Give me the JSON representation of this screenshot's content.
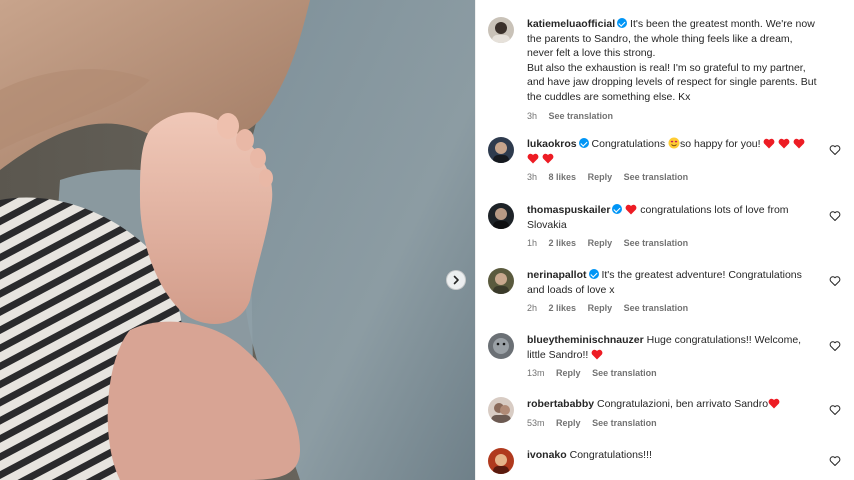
{
  "post": {
    "author": "katiemeluaofficial",
    "caption_paragraphs": [
      "It's been the greatest month. We're now the parents to Sandro, the whole thing feels like a dream, never felt a love this strong.",
      "But also the exhaustion is real! I'm so grateful to my partner, and have jaw dropping levels of respect for single parents. But the cuddles are something else. Kx"
    ],
    "time": "3h",
    "see_translation": "See translation"
  },
  "comments": [
    {
      "user": "lukaokros",
      "verified": true,
      "text_before": "Congratulations",
      "emoji": "grinning-hearts-face",
      "text_after": "so happy for you!",
      "hearts": 5,
      "time": "3h",
      "likes": "8 likes",
      "reply": "Reply",
      "see_translation": "See translation",
      "avatar_color": "#2e3b4e"
    },
    {
      "user": "thomaspuskailer",
      "verified": true,
      "emoji_before": true,
      "text": "congratulations lots of love from Slovakia",
      "time": "1h",
      "likes": "2 likes",
      "reply": "Reply",
      "see_translation": "See translation",
      "avatar_color": "#1e2328"
    },
    {
      "user": "nerinapallot",
      "verified": true,
      "text": "It's the greatest adventure! Congratulations and loads of love x",
      "time": "2h",
      "likes": "2 likes",
      "reply": "Reply",
      "see_translation": "See translation",
      "avatar_color": "#5a5a3e"
    },
    {
      "user": "blueytheminischnauzer",
      "verified": false,
      "text": "Huge congratulations!! Welcome, little Sandro!!",
      "heart_after": true,
      "time": "13m",
      "reply": "Reply",
      "see_translation": "See translation",
      "avatar_color": "#6b7075"
    },
    {
      "user": "robertababby",
      "verified": false,
      "text": "Congratulazioni, ben arrivato Sandro",
      "heart_after": true,
      "time": "53m",
      "reply": "Reply",
      "see_translation": "See translation",
      "avatar_color": "#8a7a70"
    },
    {
      "user": "ivonako",
      "verified": false,
      "text": "Congratulations!!!",
      "time": "",
      "avatar_color": "#b03a1e"
    }
  ],
  "colors": {
    "verified": "#0095f6",
    "heart": "#ed1c24",
    "meta": "#737373",
    "text": "#262626"
  },
  "icons": {
    "next": "chevron-right-icon",
    "like": "heart-outline-icon",
    "verified": "verified-badge-icon"
  }
}
